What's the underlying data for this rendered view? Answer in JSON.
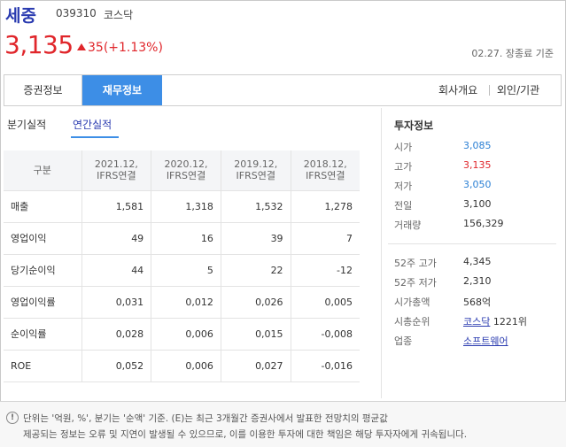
{
  "stock": {
    "name": "세중",
    "code": "039310",
    "market": "코스닥",
    "price": "3,135",
    "change": "35(+1.13%)",
    "asof": "02.27. 장종료 기준"
  },
  "tabs": {
    "items": [
      "증권정보",
      "재무정보"
    ],
    "right": [
      "회사개요",
      "외인/기관"
    ]
  },
  "subtabs": [
    "분기실적",
    "연간실적"
  ],
  "table": {
    "headers": [
      {
        "line1": "구분",
        "line2": ""
      },
      {
        "line1": "2021.12,",
        "line2": "IFRS연결"
      },
      {
        "line1": "2020.12,",
        "line2": "IFRS연결"
      },
      {
        "line1": "2019.12,",
        "line2": "IFRS연결"
      },
      {
        "line1": "2018.12,",
        "line2": "IFRS연결"
      }
    ],
    "rows": [
      {
        "label": "매출",
        "values": [
          "1,581",
          "1,318",
          "1,532",
          "1,278"
        ]
      },
      {
        "label": "영업이익",
        "values": [
          "49",
          "16",
          "39",
          "7"
        ]
      },
      {
        "label": "당기순이익",
        "values": [
          "44",
          "5",
          "22",
          "-12"
        ]
      },
      {
        "label": "영업이익률",
        "values": [
          "0,031",
          "0,012",
          "0,026",
          "0,005"
        ]
      },
      {
        "label": "순이익률",
        "values": [
          "0,028",
          "0,006",
          "0,015",
          "-0,008"
        ]
      },
      {
        "label": "ROE",
        "values": [
          "0,052",
          "0,006",
          "0,027",
          "-0,016"
        ]
      }
    ]
  },
  "investment": {
    "title": "투자정보",
    "rows": [
      {
        "key": "시가",
        "value": "3,085"
      },
      {
        "key": "고가",
        "value": "3,135"
      },
      {
        "key": "저가",
        "value": "3,050"
      },
      {
        "key": "전일",
        "value": "3,100"
      },
      {
        "key": "거래량",
        "value": "156,329"
      },
      {
        "key": "52주 고가",
        "value": "4,345"
      },
      {
        "key": "52주 저가",
        "value": "2,310"
      },
      {
        "key": "시가총액",
        "value": "568억"
      },
      {
        "key": "시총순위",
        "value": "코스닥",
        "value_suffix": "1221위"
      },
      {
        "key": "업종",
        "value": "소프트웨어"
      }
    ]
  },
  "footer": {
    "icon": "!",
    "line1": "단위는 '억원, %', 분기는 '순액' 기준. (E)는 최근 3개월간 증권사에서 발표한 전망치의 평균값",
    "line2": "제공되는 정보는 오류 및 지연이 발생될 수 있으므로, 이를 이용한 투자에 대한 책임은 해당 투자자에게 귀속됩니다."
  },
  "colors": {
    "up": "#e0262b",
    "down": "#2a7fd4",
    "accent": "#3d8ee6",
    "name": "#2a3bb0"
  }
}
